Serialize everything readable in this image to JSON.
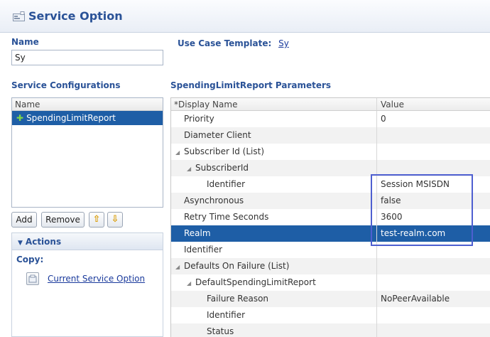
{
  "header": {
    "title": "Service Option",
    "icon": "service-option-icon"
  },
  "name_section": {
    "label": "Name",
    "value": "Sy"
  },
  "use_case": {
    "label": "Use Case Template:",
    "value": "Sy"
  },
  "service_configurations": {
    "label": "Service Configurations",
    "column_header": "Name",
    "items": [
      {
        "label": "SpendingLimitReport",
        "icon": "plus-icon",
        "selected": true
      }
    ]
  },
  "buttons": {
    "add": "Add",
    "remove": "Remove",
    "up_icon": "arrow-up-icon",
    "down_icon": "arrow-down-icon"
  },
  "actions": {
    "title": "Actions",
    "copy_label": "Copy:",
    "copy_link": "Current Service Option",
    "copy_icon": "copy-icon"
  },
  "parameters": {
    "title": "SpendingLimitReport Parameters",
    "columns": {
      "name": "*Display Name",
      "value": "Value"
    },
    "rows": [
      {
        "name": "Priority",
        "value": "0"
      },
      {
        "name": "Diameter Client",
        "value": ""
      },
      {
        "name": "Subscriber Id (List)",
        "value": "",
        "expanded": true
      },
      {
        "name": "SubscriberId",
        "value": "",
        "expanded": true
      },
      {
        "name": "Identifier",
        "value": "Session MSISDN"
      },
      {
        "name": "Asynchronous",
        "value": "false"
      },
      {
        "name": "Retry Time Seconds",
        "value": "3600"
      },
      {
        "name": "Realm",
        "value": "test-realm.com",
        "selected": true
      },
      {
        "name": "Identifier",
        "value": ""
      },
      {
        "name": "Defaults On Failure (List)",
        "value": "",
        "expanded": true
      },
      {
        "name": "DefaultSpendingLimitReport",
        "value": "",
        "expanded": true
      },
      {
        "name": "Failure Reason",
        "value": "NoPeerAvailable"
      },
      {
        "name": "Identifier",
        "value": ""
      },
      {
        "name": "Status",
        "value": ""
      }
    ]
  },
  "colors": {
    "accent": "#2a5297",
    "selection": "#1e5ea6",
    "highlight_box": "#4e5fd0"
  }
}
